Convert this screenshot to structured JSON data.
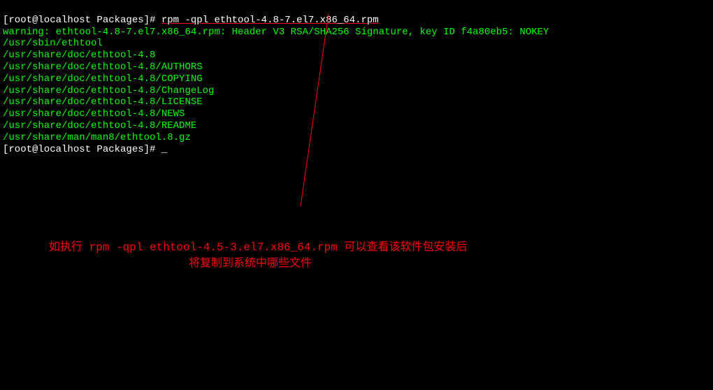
{
  "terminal": {
    "prompt1": "[root@localhost Packages]# ",
    "command1": "rpm -qpl ethtool-4.8-7.el7.x86_64.rpm",
    "warning": "warning: ethtool-4.8-7.el7.x86_64.rpm: Header V3 RSA/SHA256 Signature, key ID f4a80eb5: NOKEY",
    "files": [
      "/usr/sbin/ethtool",
      "/usr/share/doc/ethtool-4.8",
      "/usr/share/doc/ethtool-4.8/AUTHORS",
      "/usr/share/doc/ethtool-4.8/COPYING",
      "/usr/share/doc/ethtool-4.8/ChangeLog",
      "/usr/share/doc/ethtool-4.8/LICENSE",
      "/usr/share/doc/ethtool-4.8/NEWS",
      "/usr/share/doc/ethtool-4.8/README",
      "/usr/share/man/man8/ethtool.8.gz"
    ],
    "prompt2": "[root@localhost Packages]# ",
    "cursor": "_"
  },
  "annotation": {
    "line1": "如执行 rpm -qpl ethtool-4.5-3.el7.x86_64.rpm  可以查看该软件包安装后",
    "line2": "将复制到系统中哪些文件"
  }
}
